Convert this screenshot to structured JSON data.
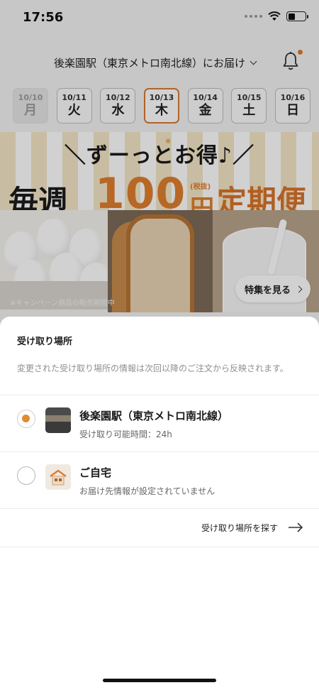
{
  "status_bar": {
    "time": "17:56"
  },
  "header": {
    "delivery_location": "後楽園駅（東京メトロ南北線）にお届け"
  },
  "dates": [
    {
      "date": "10/10",
      "weekday": "月",
      "state": "disabled"
    },
    {
      "date": "10/11",
      "weekday": "火",
      "state": "normal"
    },
    {
      "date": "10/12",
      "weekday": "水",
      "state": "normal"
    },
    {
      "date": "10/13",
      "weekday": "木",
      "state": "selected"
    },
    {
      "date": "10/14",
      "weekday": "金",
      "state": "normal"
    },
    {
      "date": "10/15",
      "weekday": "土",
      "state": "normal"
    },
    {
      "date": "10/16",
      "weekday": "日",
      "state": "normal"
    }
  ],
  "banner": {
    "headline": "＼ずーっとお得♪／",
    "asterisk": "※",
    "main_prefix": "毎週",
    "price": "100",
    "tax_label": "(税抜)",
    "yen": "円",
    "main_suffix": "定期便",
    "note": "※キャンペーン商品の販売期間中",
    "feature_button": "特集を見る"
  },
  "sheet": {
    "title": "受け取り場所",
    "note": "変更された受け取り場所の情報は次回以降のご注文から反映されます。",
    "options": [
      {
        "name": "後楽園駅（東京メトロ南北線）",
        "detail": "受け取り可能時間：24h",
        "selected": true
      },
      {
        "name": "ご自宅",
        "detail": "お届け先情報が設定されていません",
        "selected": false
      }
    ],
    "find_link": "受け取り場所を探す"
  },
  "colors": {
    "accent": "#e07f2e",
    "disabled_bg": "#e6e6e6",
    "radio_selected": "#e28a34"
  },
  "icons": [
    "wifi-icon",
    "battery-icon",
    "bell-icon",
    "chevron-down-icon",
    "chevron-right-icon",
    "arrow-right-icon",
    "station-thumbnail",
    "home-thumbnail"
  ]
}
